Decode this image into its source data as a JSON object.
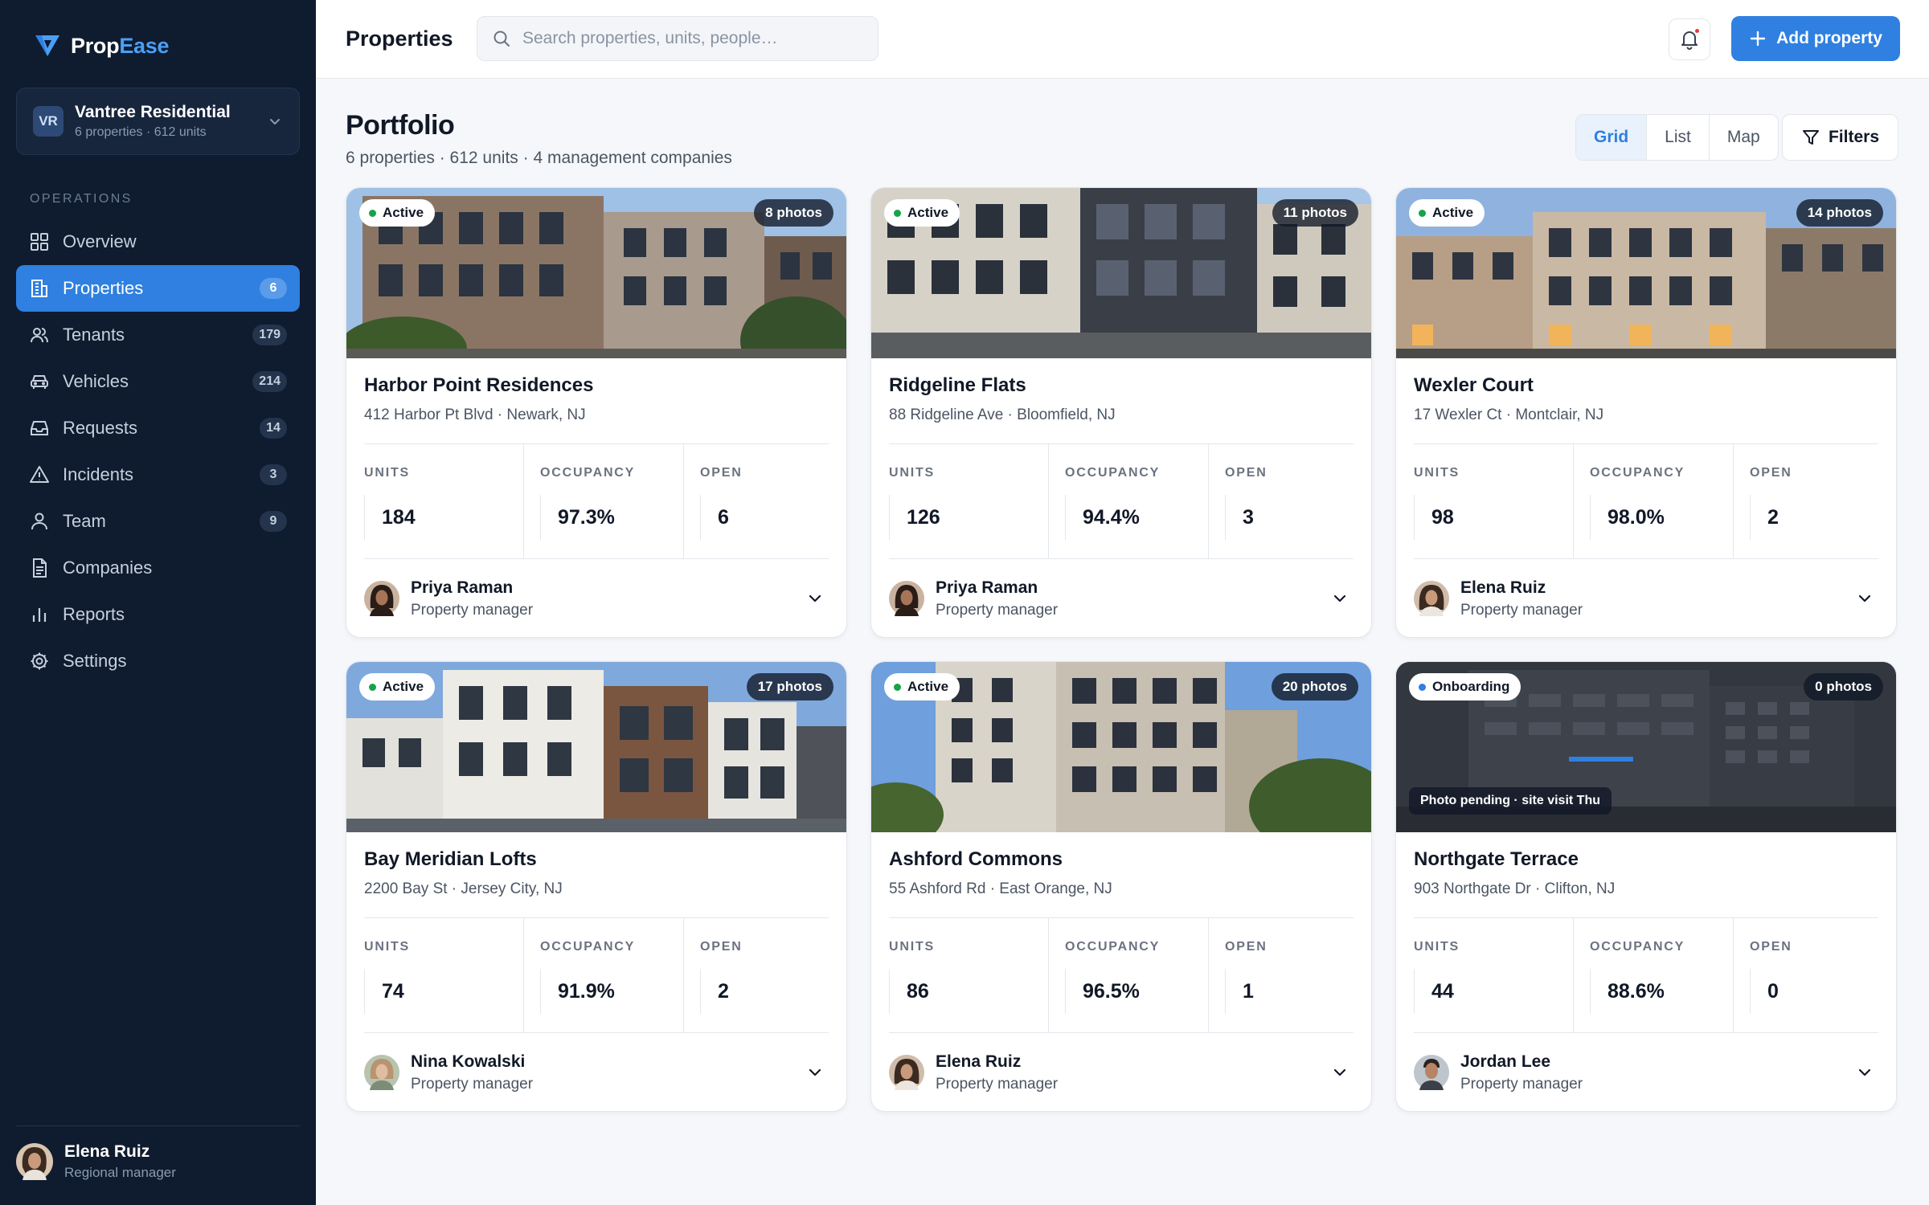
{
  "app": {
    "brand_prefix": "Prop",
    "brand_suffix": "Ease",
    "accent": "#2f80e0",
    "sidebar_bg": "#0f1b2e"
  },
  "org": {
    "initials": "VR",
    "name": "Vantree Residential",
    "summary": "6 properties · 612 units"
  },
  "sidebar": {
    "section_label": "OPERATIONS",
    "items": [
      {
        "label": "Overview",
        "count": null,
        "icon": "grid-icon"
      },
      {
        "label": "Properties",
        "count": "6",
        "icon": "building-icon",
        "active": true
      },
      {
        "label": "Tenants",
        "count": "179",
        "icon": "users-icon"
      },
      {
        "label": "Vehicles",
        "count": "214",
        "icon": "car-icon"
      },
      {
        "label": "Requests",
        "count": "14",
        "icon": "inbox-icon"
      },
      {
        "label": "Incidents",
        "count": "3",
        "icon": "warning-icon"
      },
      {
        "label": "Team",
        "count": "9",
        "icon": "person-icon"
      },
      {
        "label": "Companies",
        "count": null,
        "icon": "document-icon"
      },
      {
        "label": "Reports",
        "count": null,
        "icon": "bar-chart-icon"
      },
      {
        "label": "Settings",
        "count": null,
        "icon": "gear-icon"
      }
    ],
    "user": {
      "name": "Elena Ruiz",
      "role": "Regional manager"
    }
  },
  "topbar": {
    "title": "Properties",
    "search_placeholder": "Search properties, units, people…",
    "add_label": "Add property"
  },
  "portfolio": {
    "title": "Portfolio",
    "subtitle": "6 properties · 612 units · 4 management companies",
    "views": [
      "Grid",
      "List",
      "Map"
    ],
    "active_view": "Grid",
    "filters_label": "Filters"
  },
  "stat_labels": {
    "units": "UNITS",
    "occupancy": "OCCUPANCY",
    "open": "OPEN"
  },
  "properties": [
    {
      "status": "Active",
      "photos": "8 photos",
      "name": "Harbor Point Residences",
      "address": "412 Harbor Pt Blvd · Newark, NJ",
      "units": "184",
      "occupancy": "97.3%",
      "open": "6",
      "manager": "Priya Raman",
      "manager_role": "Property manager"
    },
    {
      "status": "Active",
      "photos": "11 photos",
      "name": "Ridgeline Flats",
      "address": "88 Ridgeline Ave · Bloomfield, NJ",
      "units": "126",
      "occupancy": "94.4%",
      "open": "3",
      "manager": "Priya Raman",
      "manager_role": "Property manager"
    },
    {
      "status": "Active",
      "photos": "14 photos",
      "name": "Wexler Court",
      "address": "17 Wexler Ct · Montclair, NJ",
      "units": "98",
      "occupancy": "98.0%",
      "open": "2",
      "manager": "Elena Ruiz",
      "manager_role": "Property manager"
    },
    {
      "status": "Active",
      "photos": "17 photos",
      "name": "Bay Meridian Lofts",
      "address": "2200 Bay St · Jersey City, NJ",
      "units": "74",
      "occupancy": "91.9%",
      "open": "2",
      "manager": "Nina Kowalski",
      "manager_role": "Property manager"
    },
    {
      "status": "Active",
      "photos": "20 photos",
      "name": "Ashford Commons",
      "address": "55 Ashford Rd · East Orange, NJ",
      "units": "86",
      "occupancy": "96.5%",
      "open": "1",
      "manager": "Elena Ruiz",
      "manager_role": "Property manager"
    },
    {
      "status": "Onboarding",
      "photos": "0 photos",
      "pending": "Photo pending · site visit Thu",
      "name": "Northgate Terrace",
      "address": "903 Northgate Dr · Clifton, NJ",
      "units": "44",
      "occupancy": "88.6%",
      "open": "0",
      "manager": "Jordan Lee",
      "manager_role": "Property manager"
    }
  ]
}
